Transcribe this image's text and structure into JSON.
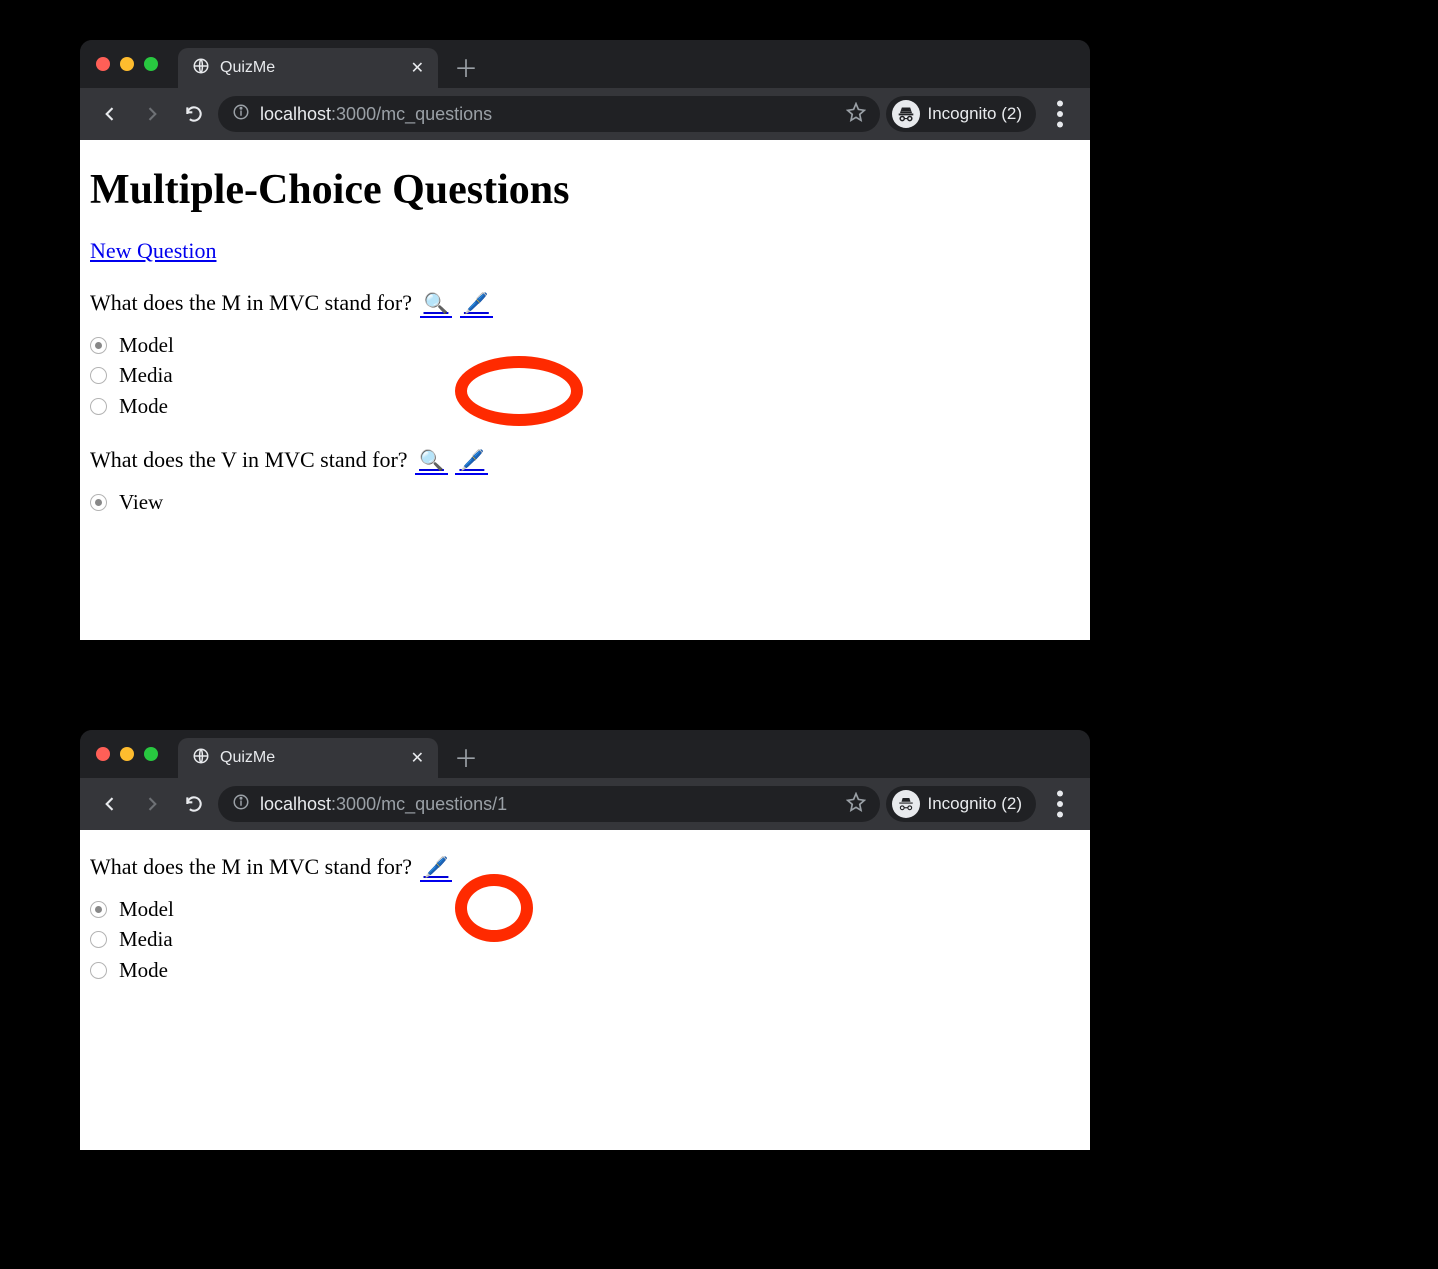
{
  "window1": {
    "tab_title": "QuizMe",
    "url": {
      "host": "localhost",
      "port": ":3000",
      "path": "/mc_questions"
    },
    "incognito_label": "Incognito (2)",
    "page": {
      "heading": "Multiple-Choice Questions",
      "new_question_link": "New Question",
      "questions": [
        {
          "text": "What does the M in MVC stand for?",
          "options": [
            "Model",
            "Media",
            "Mode"
          ],
          "checked": 0
        },
        {
          "text": "What does the V in MVC stand for?",
          "options": [
            "View"
          ],
          "checked": 0
        }
      ]
    }
  },
  "window2": {
    "tab_title": "QuizMe",
    "url": {
      "host": "localhost",
      "port": ":3000",
      "path": "/mc_questions/1"
    },
    "incognito_label": "Incognito (2)",
    "page": {
      "question": {
        "text": "What does the M in MVC stand for?",
        "options": [
          "Model",
          "Media",
          "Mode"
        ],
        "checked": 0
      }
    }
  },
  "icons": {
    "magnify": "🔍",
    "pencil": "🖊️"
  }
}
